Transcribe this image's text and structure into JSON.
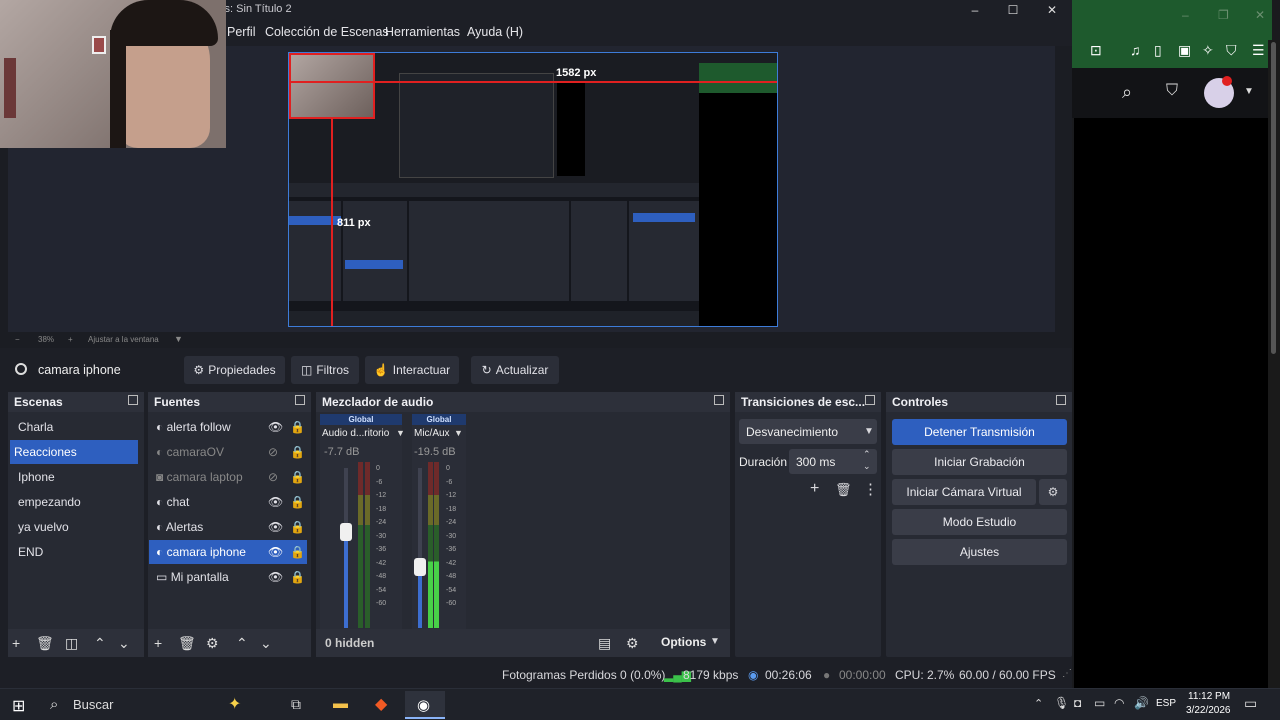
{
  "window": {
    "title": "OBS 32.1.0 - Perfil: Sin Título - Escenas: Sin Título 2",
    "minimize": "–",
    "maximize": "☐",
    "close": "✕"
  },
  "menu": [
    "Perfil",
    "Colección de Escenas",
    "Herramientas",
    "Ayuda (H)"
  ],
  "preview": {
    "overlay_width": "1582 px",
    "overlay_height": "811 px",
    "zoom_minus": "−",
    "zoom": "38%",
    "zoom_plus": "+",
    "fit_label": "Ajustar a la ventana"
  },
  "source_toolbar": {
    "selected_source": "camara iphone",
    "buttons": [
      "Propiedades",
      "Filtros",
      "Interactuar",
      "Actualizar"
    ]
  },
  "scenes": {
    "title": "Escenas",
    "items": [
      "Charla",
      "Reacciones",
      "Iphone",
      "empezando",
      "ya vuelvo",
      "END"
    ],
    "selected": "Reacciones"
  },
  "sources": {
    "title": "Fuentes",
    "items": [
      {
        "name": "alerta follow",
        "icon": "browser-icon",
        "visible": true
      },
      {
        "name": "camaraOV",
        "icon": "browser-icon",
        "visible": false
      },
      {
        "name": "camara laptop",
        "icon": "camera-icon",
        "visible": false
      },
      {
        "name": "chat",
        "icon": "browser-icon",
        "visible": true
      },
      {
        "name": "Alertas",
        "icon": "browser-icon",
        "visible": true
      },
      {
        "name": "camara iphone",
        "icon": "browser-icon",
        "visible": true
      },
      {
        "name": "Mi pantalla",
        "icon": "monitor-icon",
        "visible": true
      }
    ],
    "selected": "camara iphone"
  },
  "mixer": {
    "title": "Mezclador de audio",
    "channels": [
      {
        "tag": "Global",
        "name": "Audio d...ritorio",
        "db": "-7.7 dB",
        "level": 0.6
      },
      {
        "tag": "Global",
        "name": "Mic/Aux",
        "db": "-19.5 dB",
        "level": 0.38
      }
    ],
    "scale": [
      "0",
      "-6",
      "-12",
      "-18",
      "-24",
      "-30",
      "-36",
      "-42",
      "-48",
      "-54",
      "-60"
    ],
    "hidden": "0 hidden",
    "options": "Options"
  },
  "transitions": {
    "title": "Transiciones de esc...",
    "selected": "Desvanecimiento",
    "duration_label": "Duración",
    "duration_value": "300 ms"
  },
  "controls": {
    "title": "Controles",
    "buttons": [
      "Detener Transmisión",
      "Iniciar Grabación",
      "Iniciar Cámara Virtual",
      "Modo Estudio",
      "Ajustes"
    ]
  },
  "status": {
    "dropped": "Fotogramas Perdidos 0 (0.0%)",
    "bitrate": "8179 kbps",
    "stream_time": "00:26:06",
    "rec_time": "00:00:00",
    "cpu": "CPU: 2.7%",
    "fps": "60.00 / 60.00 FPS"
  },
  "taskbar": {
    "search_placeholder": "Buscar",
    "lang": "ESP",
    "time": "11:12 PM",
    "date": "3/22/2026"
  },
  "colors": {
    "accent": "#2e5fbf",
    "panel": "#272a33",
    "background": "#1d1f26",
    "browser_green": "#1e5a2d"
  }
}
